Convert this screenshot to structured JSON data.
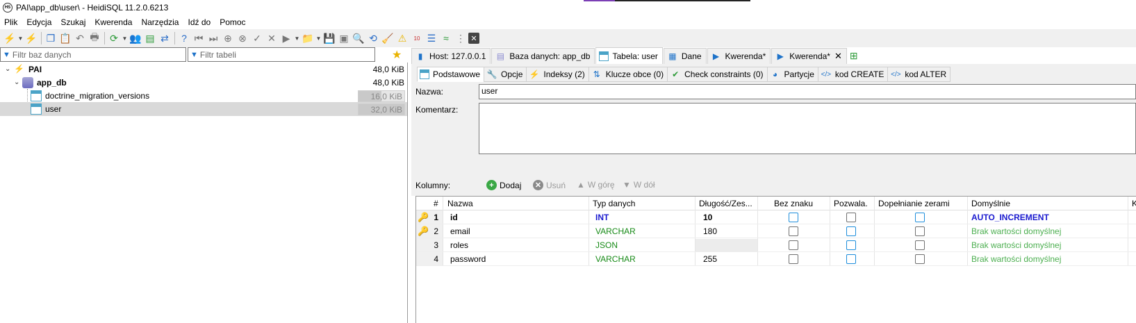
{
  "window": {
    "title": "PAI\\app_db\\user\\ - HeidiSQL 11.2.0.6213",
    "app_icon": "HS"
  },
  "menu": [
    "Plik",
    "Edycja",
    "Szukaj",
    "Kwerenda",
    "Narzędzia",
    "Idź do",
    "Pomoc"
  ],
  "filters": {
    "db_placeholder": "Filtr baz danych",
    "table_placeholder": "Filtr tabeli"
  },
  "tree": {
    "server": {
      "label": "PAI",
      "size": "48,0 KiB"
    },
    "database": {
      "label": "app_db",
      "size": "48,0 KiB"
    },
    "tables": [
      {
        "label": "doctrine_migration_versions",
        "size": "16,0 KiB",
        "fill": 0.5
      },
      {
        "label": "user",
        "size": "32,0 KiB",
        "fill": 1.0
      }
    ]
  },
  "main_tabs": [
    {
      "label": "Host: 127.0.0.1",
      "icon": "host-icon"
    },
    {
      "label": "Baza danych: app_db",
      "icon": "database-icon"
    },
    {
      "label": "Tabela: user",
      "icon": "table-icon"
    },
    {
      "label": "Dane",
      "icon": "grid-icon"
    },
    {
      "label": "Kwerenda*",
      "icon": "play-icon"
    },
    {
      "label": "Kwerenda*",
      "icon": "play-icon"
    }
  ],
  "sub_tabs": [
    {
      "label": "Podstawowe",
      "icon": "table-icon"
    },
    {
      "label": "Opcje",
      "icon": "wrench-icon"
    },
    {
      "label": "Indeksy (2)",
      "icon": "lightning-icon"
    },
    {
      "label": "Klucze obce (0)",
      "icon": "foreign-key-icon"
    },
    {
      "label": "Check constraints (0)",
      "icon": "check-icon"
    },
    {
      "label": "Partycje",
      "icon": "pie-icon"
    },
    {
      "label": "kod CREATE",
      "icon": "code-icon"
    },
    {
      "label": "kod ALTER",
      "icon": "code-icon"
    }
  ],
  "form": {
    "name_label": "Nazwa:",
    "name_value": "user",
    "comment_label": "Komentarz:",
    "comment_value": ""
  },
  "columns_bar": {
    "label": "Kolumny:",
    "add": "Dodaj",
    "remove": "Usuń",
    "up": "W górę",
    "down": "W dół"
  },
  "grid": {
    "headers": [
      "#",
      "Nazwa",
      "Typ danych",
      "Długość/Zes...",
      "Bez znaku",
      "Pozwala...",
      "Dopełnianie zerami",
      "Domyślnie",
      "K"
    ],
    "rows": [
      {
        "num": "1",
        "name": "id",
        "type": "INT",
        "length": "10",
        "unsigned": false,
        "allow_null": false,
        "zerofill": false,
        "default": "AUTO_INCREMENT",
        "key": "primary"
      },
      {
        "num": "2",
        "name": "email",
        "type": "VARCHAR",
        "length": "180",
        "unsigned": false,
        "allow_null": false,
        "zerofill": false,
        "default": "Brak wartości domyślnej",
        "key": "unique"
      },
      {
        "num": "3",
        "name": "roles",
        "type": "JSON",
        "length": "",
        "unsigned": false,
        "allow_null": false,
        "zerofill": false,
        "default": "Brak wartości domyślnej",
        "key": ""
      },
      {
        "num": "4",
        "name": "password",
        "type": "VARCHAR",
        "length": "255",
        "unsigned": false,
        "allow_null": false,
        "zerofill": false,
        "default": "Brak wartości domyślnej",
        "key": ""
      }
    ]
  },
  "colors": {
    "int_type": "#1a1acf",
    "varchar_type": "#168a16",
    "default_green": "#4caf50",
    "auto_inc": "#1a1acf"
  }
}
